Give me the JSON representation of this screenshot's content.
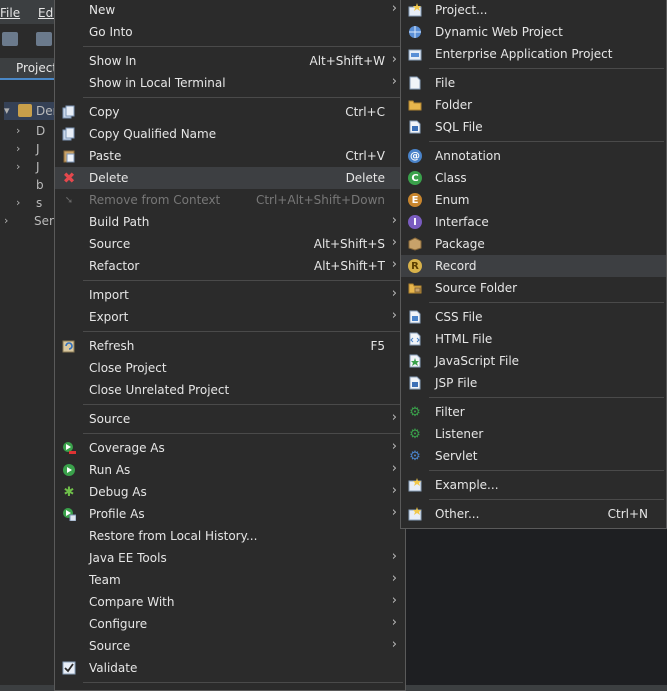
{
  "background": {
    "menubar": [
      "File",
      "Edit"
    ],
    "project_tab": "Project",
    "tree": [
      "Den",
      "D",
      "J",
      "J",
      "b",
      "s",
      "Serv"
    ]
  },
  "context_menu": {
    "items": [
      {
        "label": "New",
        "shortcut": "",
        "submenu": true,
        "icon": ""
      },
      {
        "label": "Go Into",
        "shortcut": "",
        "submenu": false,
        "icon": ""
      },
      {
        "label": "Show In",
        "shortcut": "Alt+Shift+W",
        "submenu": true,
        "icon": ""
      },
      {
        "label": "Show in Local Terminal",
        "shortcut": "",
        "submenu": true,
        "icon": ""
      },
      {
        "label": "Copy",
        "shortcut": "Ctrl+C",
        "submenu": false,
        "icon": "copy-icon"
      },
      {
        "label": "Copy Qualified Name",
        "shortcut": "",
        "submenu": false,
        "icon": "copy-icon"
      },
      {
        "label": "Paste",
        "shortcut": "Ctrl+V",
        "submenu": false,
        "icon": "paste-icon"
      },
      {
        "label": "Delete",
        "shortcut": "Delete",
        "submenu": false,
        "icon": "delete-icon"
      },
      {
        "label": "Remove from Context",
        "shortcut": "Ctrl+Alt+Shift+Down",
        "submenu": false,
        "icon": "remove-context-icon",
        "disabled": true
      },
      {
        "label": "Build Path",
        "shortcut": "",
        "submenu": true,
        "icon": ""
      },
      {
        "label": "Source",
        "shortcut": "Alt+Shift+S",
        "submenu": true,
        "icon": ""
      },
      {
        "label": "Refactor",
        "shortcut": "Alt+Shift+T",
        "submenu": true,
        "icon": ""
      },
      {
        "label": "Import",
        "shortcut": "",
        "submenu": true,
        "icon": ""
      },
      {
        "label": "Export",
        "shortcut": "",
        "submenu": true,
        "icon": ""
      },
      {
        "label": "Refresh",
        "shortcut": "F5",
        "submenu": false,
        "icon": "refresh-icon"
      },
      {
        "label": "Close Project",
        "shortcut": "",
        "submenu": false,
        "icon": ""
      },
      {
        "label": "Close Unrelated Project",
        "shortcut": "",
        "submenu": false,
        "icon": ""
      },
      {
        "label": "Source",
        "shortcut": "",
        "submenu": true,
        "icon": ""
      },
      {
        "label": "Coverage As",
        "shortcut": "",
        "submenu": true,
        "icon": "coverage-icon"
      },
      {
        "label": "Run As",
        "shortcut": "",
        "submenu": true,
        "icon": "run-icon"
      },
      {
        "label": "Debug As",
        "shortcut": "",
        "submenu": true,
        "icon": "debug-icon"
      },
      {
        "label": "Profile As",
        "shortcut": "",
        "submenu": true,
        "icon": "profile-icon"
      },
      {
        "label": "Restore from Local History...",
        "shortcut": "",
        "submenu": false,
        "icon": ""
      },
      {
        "label": "Java EE Tools",
        "shortcut": "",
        "submenu": true,
        "icon": ""
      },
      {
        "label": "Team",
        "shortcut": "",
        "submenu": true,
        "icon": ""
      },
      {
        "label": "Compare With",
        "shortcut": "",
        "submenu": true,
        "icon": ""
      },
      {
        "label": "Configure",
        "shortcut": "",
        "submenu": true,
        "icon": ""
      },
      {
        "label": "Source",
        "shortcut": "",
        "submenu": true,
        "icon": ""
      },
      {
        "label": "Validate",
        "shortcut": "",
        "submenu": false,
        "icon": "checkbox-checked-icon"
      }
    ]
  },
  "new_submenu": {
    "items": [
      {
        "label": "Project...",
        "shortcut": "",
        "icon": "new-project-icon"
      },
      {
        "label": "Dynamic Web Project",
        "shortcut": "",
        "icon": "web-project-icon"
      },
      {
        "label": "Enterprise Application Project",
        "shortcut": "",
        "icon": "ear-project-icon"
      },
      {
        "label": "File",
        "shortcut": "",
        "icon": "file-icon"
      },
      {
        "label": "Folder",
        "shortcut": "",
        "icon": "folder-icon"
      },
      {
        "label": "SQL File",
        "shortcut": "",
        "icon": "sql-file-icon"
      },
      {
        "label": "Annotation",
        "shortcut": "",
        "icon": "annotation-icon"
      },
      {
        "label": "Class",
        "shortcut": "",
        "icon": "class-icon"
      },
      {
        "label": "Enum",
        "shortcut": "",
        "icon": "enum-icon"
      },
      {
        "label": "Interface",
        "shortcut": "",
        "icon": "interface-icon"
      },
      {
        "label": "Package",
        "shortcut": "",
        "icon": "package-icon"
      },
      {
        "label": "Record",
        "shortcut": "",
        "icon": "record-icon"
      },
      {
        "label": "Source Folder",
        "shortcut": "",
        "icon": "source-folder-icon"
      },
      {
        "label": "CSS File",
        "shortcut": "",
        "icon": "css-file-icon"
      },
      {
        "label": "HTML File",
        "shortcut": "",
        "icon": "html-file-icon"
      },
      {
        "label": "JavaScript File",
        "shortcut": "",
        "icon": "js-file-icon"
      },
      {
        "label": "JSP File",
        "shortcut": "",
        "icon": "jsp-file-icon"
      },
      {
        "label": "Filter",
        "shortcut": "",
        "icon": "filter-icon"
      },
      {
        "label": "Listener",
        "shortcut": "",
        "icon": "listener-icon"
      },
      {
        "label": "Servlet",
        "shortcut": "",
        "icon": "servlet-icon"
      },
      {
        "label": "Example...",
        "shortcut": "",
        "icon": "example-icon"
      },
      {
        "label": "Other...",
        "shortcut": "Ctrl+N",
        "icon": "other-icon"
      }
    ]
  }
}
